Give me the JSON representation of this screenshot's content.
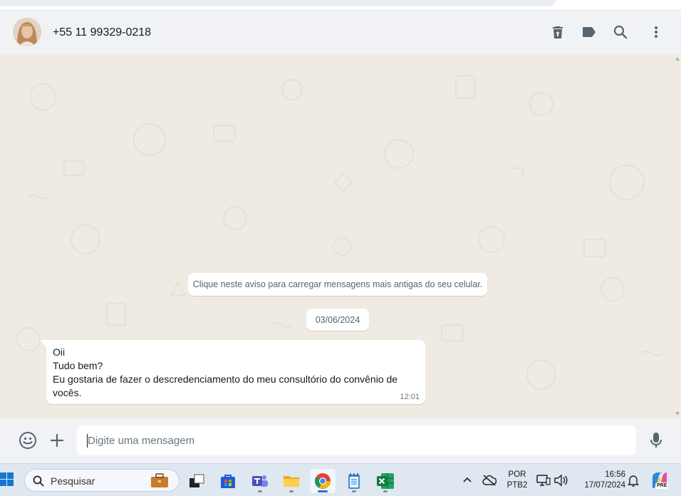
{
  "header": {
    "contact_name": "+55 11 99329-0218",
    "icons": [
      "delete-icon",
      "label-icon",
      "search-icon",
      "menu-icon"
    ]
  },
  "chat": {
    "notice": "Clique neste aviso para carregar mensagens mais antigas do seu celular.",
    "date": "03/06/2024",
    "message": {
      "lines": [
        "Oii",
        "Tudo bem?",
        "Eu gostaria de fazer o descredenciamento do meu consultório do convênio de",
        "vocês."
      ],
      "time": "12:01"
    }
  },
  "composer": {
    "placeholder": "Digite uma mensagem",
    "icons": [
      "emoji-icon",
      "plus-icon",
      "microphone-icon"
    ]
  },
  "taskbar": {
    "search_label": "Pesquisar",
    "apps": [
      "widgets",
      "file-explorer-dark",
      "microsoft-store",
      "teams",
      "file-explorer",
      "chrome",
      "notepad",
      "excel"
    ],
    "lang_top": "POR",
    "lang_bottom": "PTB2",
    "time": "16:56",
    "date": "17/07/2024",
    "copilot_badge": "PRE"
  },
  "colors": {
    "chat_background": "#efeae2",
    "header_background": "#f0f2f5",
    "bubble": "#ffffff",
    "icon": "#54656f"
  }
}
